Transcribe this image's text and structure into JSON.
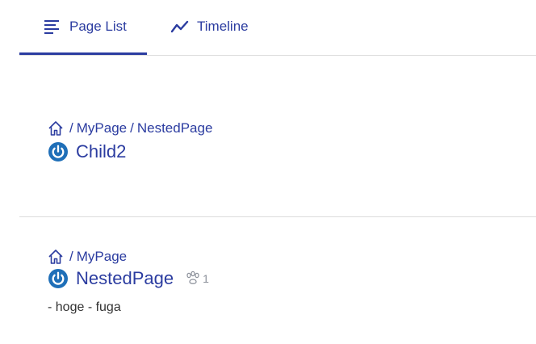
{
  "tabs": [
    {
      "label": "Page List",
      "icon": "list-icon",
      "active": true
    },
    {
      "label": "Timeline",
      "icon": "timeline-icon",
      "active": false
    }
  ],
  "colors": {
    "accent": "#2b3ca0",
    "divider": "#dcdcdc",
    "power_icon": "#1f6fb8",
    "muted": "#8a8f99"
  },
  "items": [
    {
      "breadcrumb": [
        "MyPage",
        "NestedPage"
      ],
      "title": "Child2",
      "icon": "power-icon"
    },
    {
      "breadcrumb": [
        "MyPage"
      ],
      "title": "NestedPage",
      "icon": "power-icon",
      "like_count": "1",
      "excerpt": "- hoge - fuga"
    }
  ]
}
